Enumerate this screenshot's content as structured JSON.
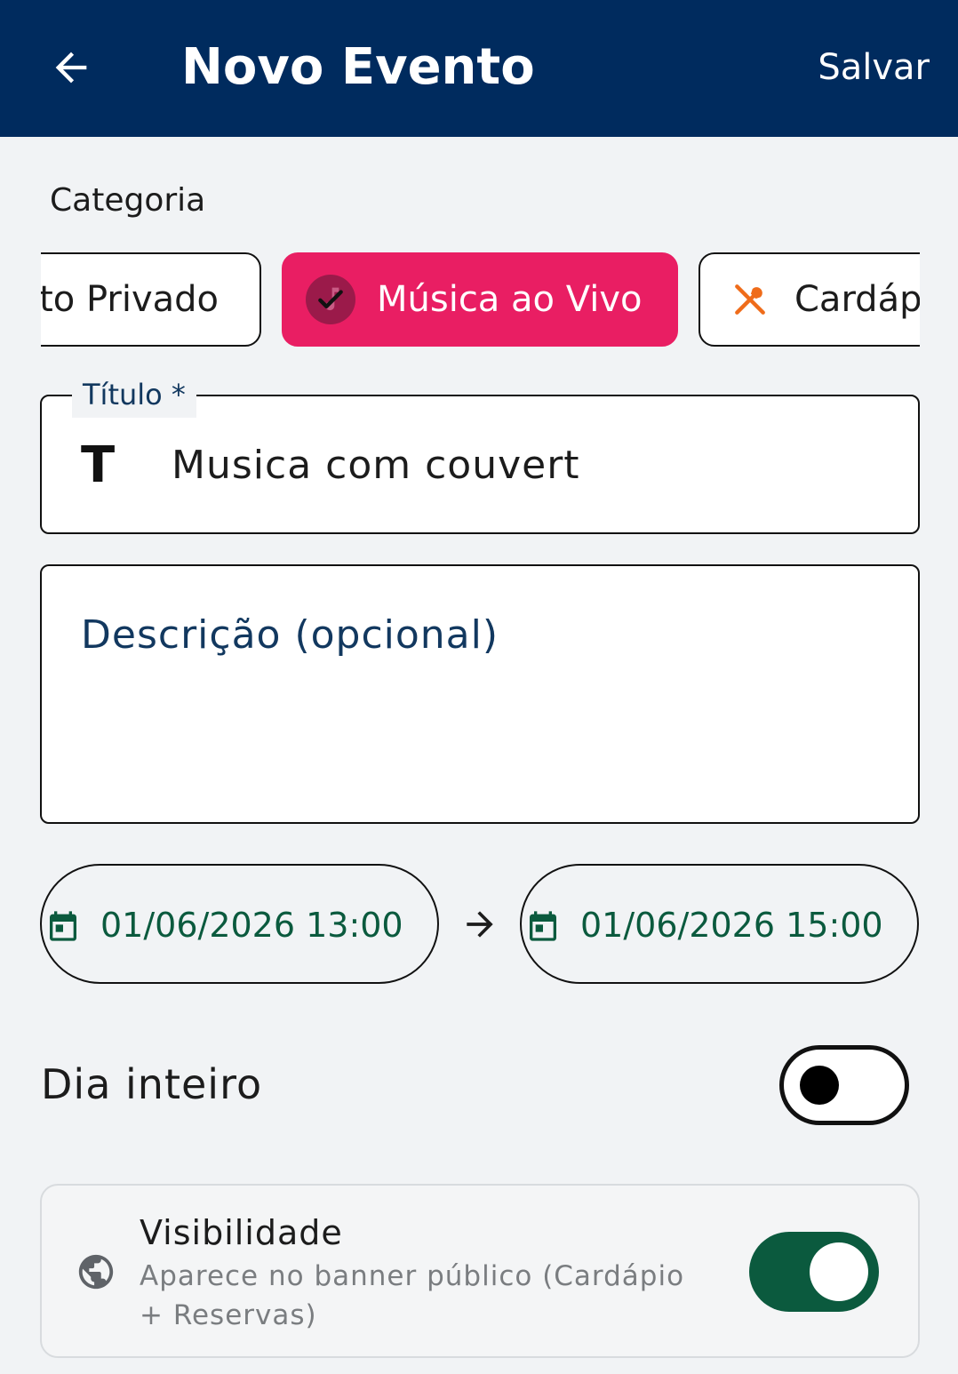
{
  "appbar": {
    "title": "Novo Evento",
    "save_label": "Salvar",
    "back_icon": "arrow-left-icon",
    "background": "#002b5e"
  },
  "category": {
    "label": "Categoria",
    "chips": [
      {
        "label": "to Privado",
        "selected": false
      },
      {
        "label": "Música ao Vivo",
        "selected": true,
        "icon": "check-icon",
        "color": "#e91e63"
      },
      {
        "label": "Cardáp",
        "selected": false,
        "icon": "utensils-icon",
        "icon_color": "#ef6c1a"
      }
    ]
  },
  "title_field": {
    "label": "Título *",
    "icon": "text-format-icon",
    "icon_glyph": "T",
    "value": "Musica com couvert"
  },
  "description_field": {
    "placeholder": "Descrição (opcional)"
  },
  "dates": {
    "start": "01/06/2026 13:00",
    "end": "01/06/2026 15:00",
    "icon": "calendar-icon",
    "separator_icon": "arrow-right-icon",
    "text_color": "#0b5a3e"
  },
  "all_day": {
    "label": "Dia inteiro",
    "enabled": false
  },
  "visibility": {
    "title": "Visibilidade",
    "subtitle": "Aparece no banner público (Cardápio + Reservas)",
    "icon": "globe-icon",
    "enabled": true,
    "accent": "#0b5a3e"
  }
}
